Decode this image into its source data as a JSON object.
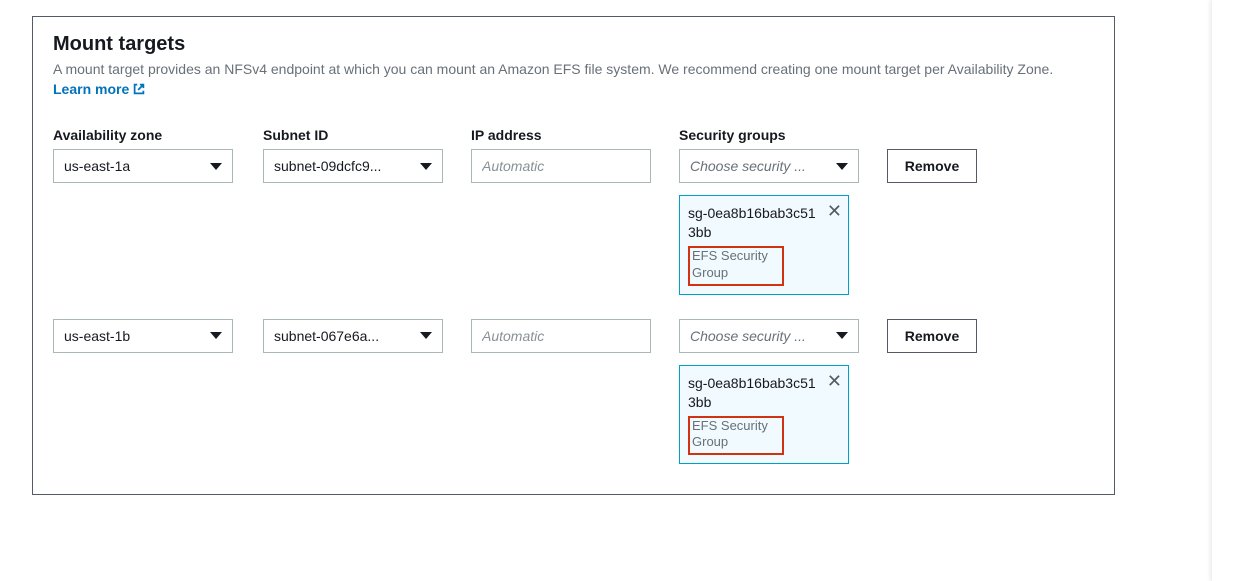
{
  "panel": {
    "title": "Mount targets",
    "description": "A mount target provides an NFSv4 endpoint at which you can mount an Amazon EFS file system. We recommend creating one mount target per Availability Zone.",
    "learn_more": "Learn more"
  },
  "headers": {
    "az": "Availability zone",
    "subnet": "Subnet ID",
    "ip": "IP address",
    "sg": "Security groups"
  },
  "rows": [
    {
      "az": "us-east-1a",
      "subnet": "subnet-09dcfc9...",
      "ip_placeholder": "Automatic",
      "sg_placeholder": "Choose security ...",
      "sg_chip_id": "sg-0ea8b16bab3c513bb",
      "sg_chip_name": "EFS Security Group",
      "remove": "Remove"
    },
    {
      "az": "us-east-1b",
      "subnet": "subnet-067e6a...",
      "ip_placeholder": "Automatic",
      "sg_placeholder": "Choose security ...",
      "sg_chip_id": "sg-0ea8b16bab3c513bb",
      "sg_chip_name": "EFS Security Group",
      "remove": "Remove"
    }
  ]
}
